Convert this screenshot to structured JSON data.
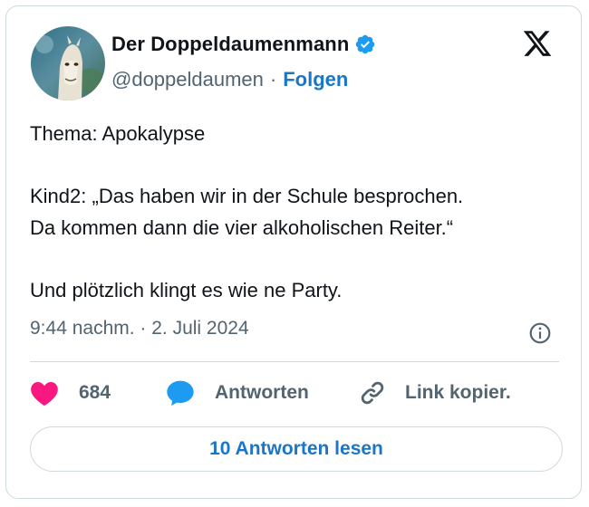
{
  "author": {
    "name": "Der Doppeldaumenmann",
    "handle": "@doppeldaumen",
    "separator": "·",
    "follow_label": "Folgen"
  },
  "tweet": {
    "lines": [
      "Thema: Apokalypse",
      "",
      "Kind2: „Das haben wir in der Schule besprochen.",
      "Da kommen dann die vier alkoholischen Reiter.“",
      "",
      "Und plötzlich klingt es wie ne Party."
    ],
    "timestamp": "9:44 nachm. · 2. Juli 2024"
  },
  "actions": {
    "likes_count": "684",
    "reply_label": "Antworten",
    "copy_link_label": "Link kopier."
  },
  "read_replies_label": "10 Antworten lesen",
  "icons": {
    "verified": "verified-badge-icon",
    "platform": "x-logo-icon",
    "info": "info-icon",
    "like": "heart-icon",
    "reply": "speech-bubble-icon",
    "link": "link-icon"
  },
  "colors": {
    "accent": "#1a76c8",
    "verified": "#1d9bf0",
    "heart": "#f91880",
    "muted": "#536471",
    "border": "#cfd9de"
  }
}
